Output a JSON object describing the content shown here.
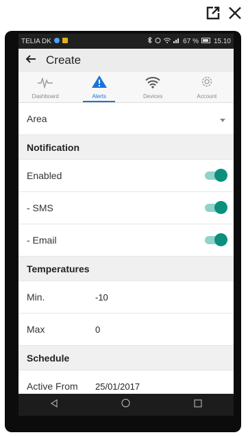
{
  "window": {
    "external_icon": "external-link-icon",
    "close_icon": "close-icon"
  },
  "status_bar": {
    "carrier": "TELIA DK",
    "battery_percent": "67 %",
    "time": "15.10"
  },
  "app_bar": {
    "title": "Create"
  },
  "tabs": [
    {
      "label": "Dashboard",
      "icon": "pulse-icon",
      "active": false
    },
    {
      "label": "Alerts",
      "icon": "alert-icon",
      "active": true
    },
    {
      "label": "Devices",
      "icon": "wifi-icon",
      "active": false
    },
    {
      "label": "Account",
      "icon": "gear-icon",
      "active": false
    }
  ],
  "form": {
    "area_label": "Area",
    "notification_section": "Notification",
    "enabled_label": "Enabled",
    "enabled_on": true,
    "sms_label": "- SMS",
    "sms_on": true,
    "email_label": "- Email",
    "email_on": true,
    "temperatures_section": "Temperatures",
    "min_label": "Min.",
    "min_value": "-10",
    "max_label": "Max",
    "max_value": "0",
    "schedule_section": "Schedule",
    "active_from_label": "Active From",
    "active_from_value": "25/01/2017"
  },
  "colors": {
    "toggle_on": "#0d8f7f",
    "tab_active": "#1a73d8"
  }
}
